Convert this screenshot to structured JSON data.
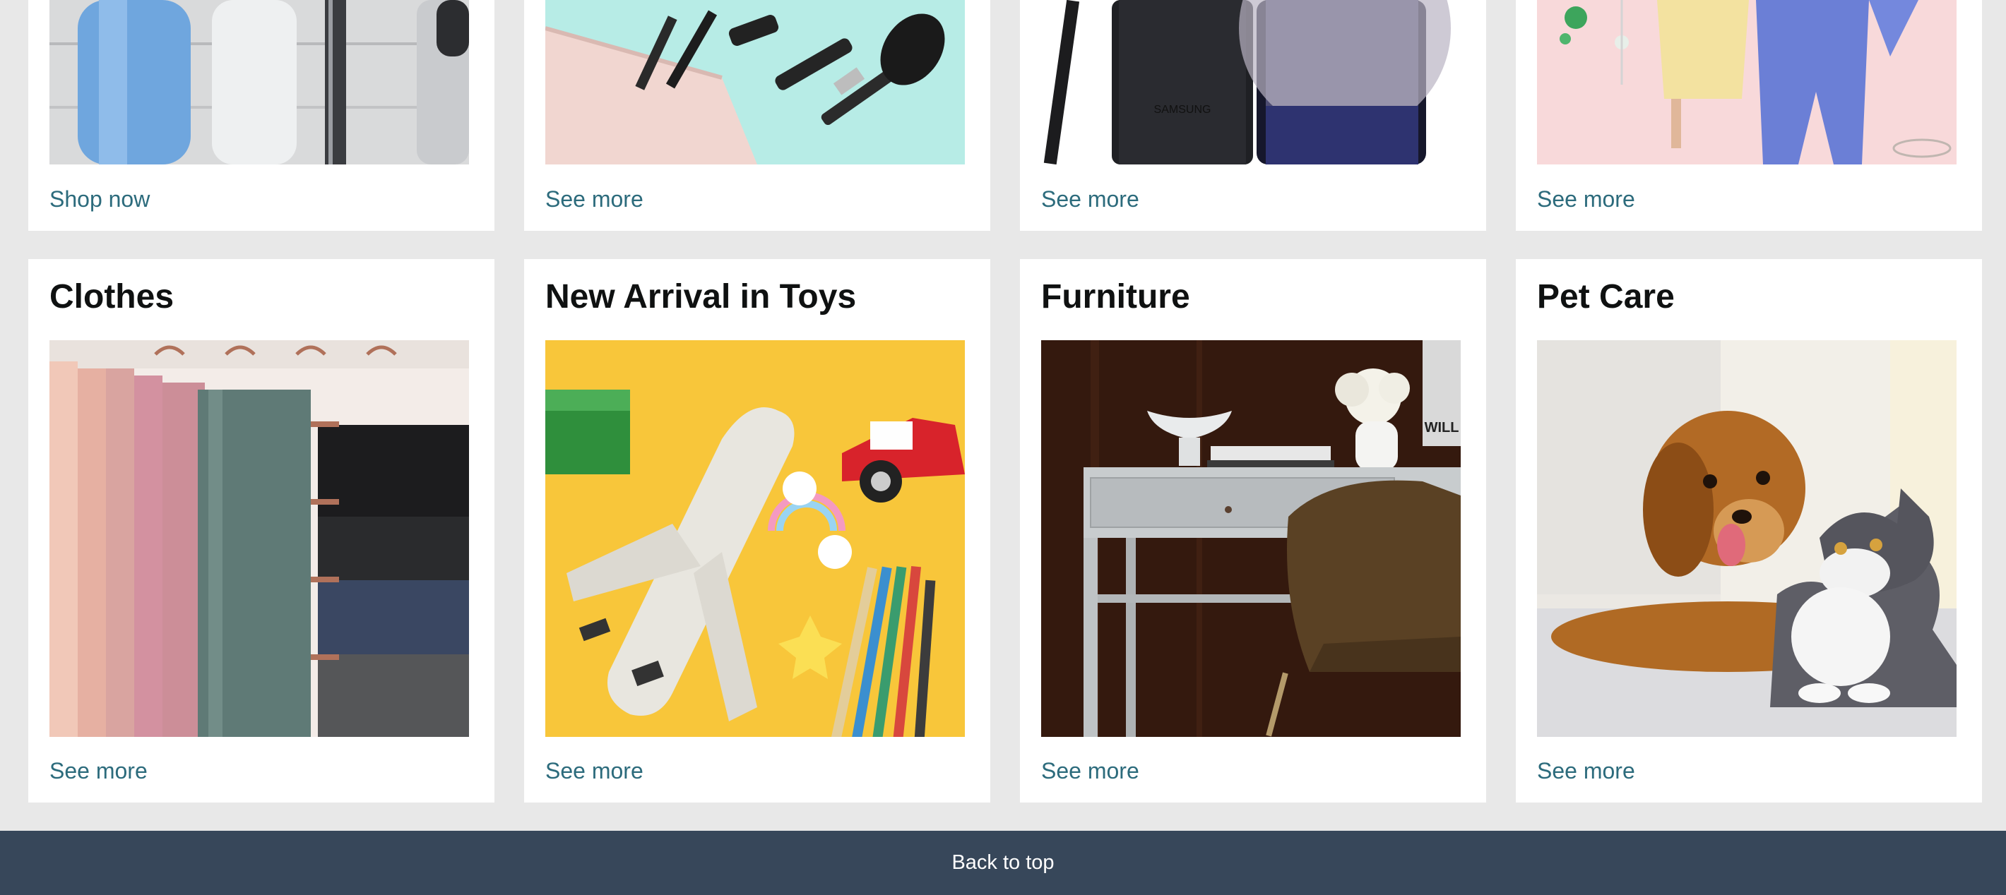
{
  "top_row": [
    {
      "link": "Shop now",
      "image": "razors-and-trimmers-image"
    },
    {
      "link": "See more",
      "image": "makeup-bag-image"
    },
    {
      "link": "See more",
      "image": "samsung-phone-image",
      "image_text": "SAMSUNG"
    },
    {
      "link": "See more",
      "image": "fashion-models-image"
    }
  ],
  "bottom_row": [
    {
      "title": "Clothes",
      "link": "See more",
      "image": "hanging-clothes-image"
    },
    {
      "title": "New Arrival in Toys",
      "link": "See more",
      "image": "toy-airplane-image"
    },
    {
      "title": "Furniture",
      "link": "See more",
      "image": "desk-chair-image",
      "image_text": "WILL"
    },
    {
      "title": "Pet Care",
      "link": "See more",
      "image": "dog-and-cat-image"
    }
  ],
  "footer": {
    "back_to_top": "Back to top"
  },
  "colors": {
    "page_bg": "#e8e8e8",
    "card_bg": "#ffffff",
    "link": "#2c6b7c",
    "footer_bg": "#37475a",
    "footer_text": "#ffffff"
  }
}
